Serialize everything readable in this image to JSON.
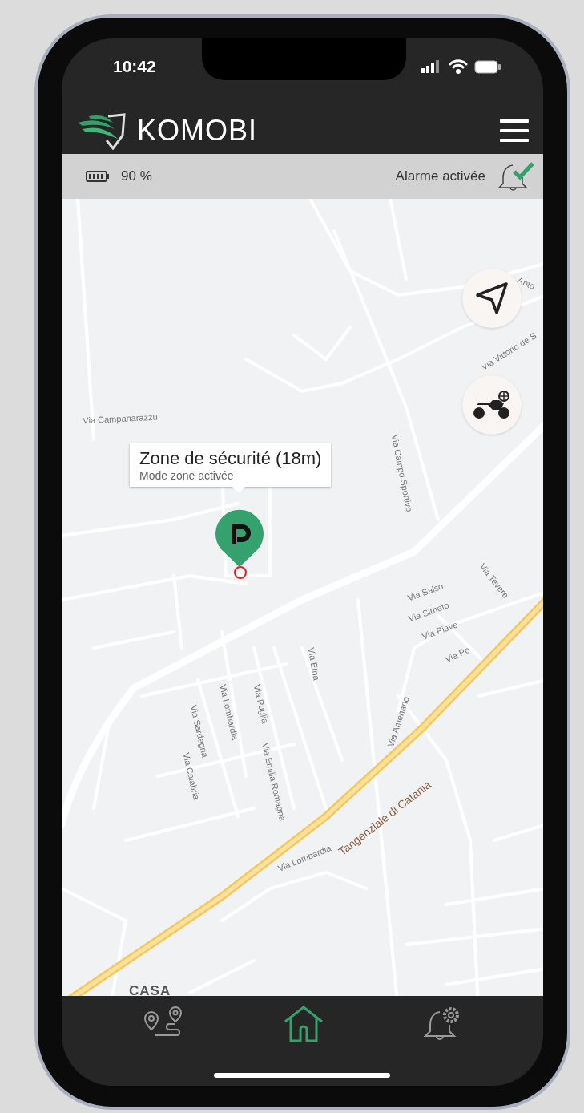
{
  "status_bar": {
    "time": "10:42"
  },
  "header": {
    "brand": "KOMOBI"
  },
  "info_bar": {
    "battery": "90 %",
    "alarm": "Alarme activée",
    "alarm_on": true
  },
  "map": {
    "labels": [
      {
        "text": "Anto",
        "kind": "street"
      },
      {
        "text": "Via Vittorio de S",
        "kind": "street"
      },
      {
        "text": "Via Campanarazzu",
        "kind": "street"
      },
      {
        "text": "Via Campo Sportivo",
        "kind": "street"
      },
      {
        "text": "Via Tevere",
        "kind": "street"
      },
      {
        "text": "Via Salso",
        "kind": "street"
      },
      {
        "text": "Via Simeto",
        "kind": "street"
      },
      {
        "text": "Via Piave",
        "kind": "street"
      },
      {
        "text": "Via Po",
        "kind": "street"
      },
      {
        "text": "Via Etna",
        "kind": "street"
      },
      {
        "text": "Via Lombardia",
        "kind": "street"
      },
      {
        "text": "Via Puglia",
        "kind": "street"
      },
      {
        "text": "Via Amenano",
        "kind": "street"
      },
      {
        "text": "Via Sardegna",
        "kind": "street"
      },
      {
        "text": "Via Emilia Romagna",
        "kind": "street"
      },
      {
        "text": "Via Calabria",
        "kind": "street"
      },
      {
        "text": "Tangenziale di Catania",
        "kind": "highway"
      },
      {
        "text": "Via Lombardia",
        "kind": "street"
      },
      {
        "text": "CASA",
        "kind": "place"
      }
    ],
    "zone_popup": {
      "title": "Zone de sécurité (18m)",
      "subtitle": "Mode zone activée"
    }
  },
  "nav": [
    {
      "kind": "route",
      "selected": false
    },
    {
      "kind": "home",
      "selected": true
    },
    {
      "kind": "alarm-settings",
      "selected": false
    }
  ]
}
